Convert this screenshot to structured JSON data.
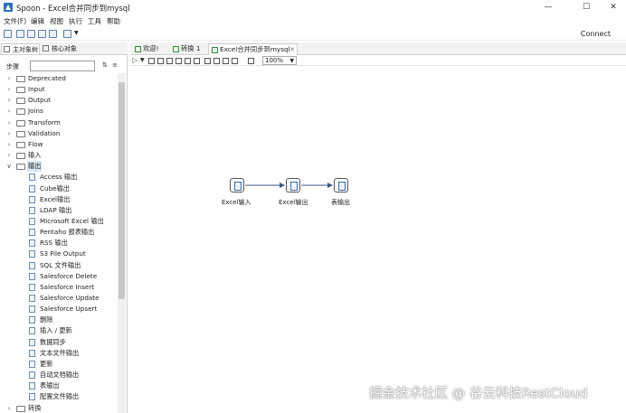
{
  "window": {
    "title": "Spoon - Excel合并同步到mysql"
  },
  "menu": [
    "文件(F)",
    "编辑",
    "视图",
    "执行",
    "工具",
    "帮助"
  ],
  "toolbar": {
    "connect_label": "Connect"
  },
  "left_tabs": [
    "主对象树",
    "核心对象"
  ],
  "steps_label": "步骤",
  "tree": [
    {
      "label": "Deprecated",
      "type": "folder",
      "expanded": false
    },
    {
      "label": "Input",
      "type": "folder",
      "expanded": false
    },
    {
      "label": "Output",
      "type": "folder",
      "expanded": false
    },
    {
      "label": "Joins",
      "type": "folder",
      "expanded": false
    },
    {
      "label": "Transform",
      "type": "folder",
      "expanded": false
    },
    {
      "label": "Validation",
      "type": "folder",
      "expanded": false
    },
    {
      "label": "Flow",
      "type": "folder",
      "expanded": false
    },
    {
      "label": "输入",
      "type": "folder",
      "expanded": false
    },
    {
      "label": "输出",
      "type": "folder",
      "expanded": true
    },
    {
      "label": "Access 输出",
      "type": "leaf"
    },
    {
      "label": "Cube输出",
      "type": "leaf"
    },
    {
      "label": "Excel输出",
      "type": "leaf"
    },
    {
      "label": "LDAP 输出",
      "type": "leaf"
    },
    {
      "label": "Microsoft Excel 输出",
      "type": "leaf"
    },
    {
      "label": "Pentaho 报表输出",
      "type": "leaf"
    },
    {
      "label": "RSS 输出",
      "type": "leaf"
    },
    {
      "label": "S3 File Output",
      "type": "leaf"
    },
    {
      "label": "SQL 文件输出",
      "type": "leaf"
    },
    {
      "label": "Salesforce Delete",
      "type": "leaf"
    },
    {
      "label": "Salesforce Insert",
      "type": "leaf"
    },
    {
      "label": "Salesforce Update",
      "type": "leaf"
    },
    {
      "label": "Salesforce Upsert",
      "type": "leaf"
    },
    {
      "label": "删除",
      "type": "leaf"
    },
    {
      "label": "插入 / 更新",
      "type": "leaf"
    },
    {
      "label": "数据同步",
      "type": "leaf"
    },
    {
      "label": "文本文件输出",
      "type": "leaf"
    },
    {
      "label": "更新",
      "type": "leaf"
    },
    {
      "label": "自动文档输出",
      "type": "leaf"
    },
    {
      "label": "表输出",
      "type": "leaf"
    },
    {
      "label": "配置文件输出",
      "type": "leaf"
    },
    {
      "label": "转换",
      "type": "folder",
      "expanded": false
    }
  ],
  "right_tabs": [
    {
      "label": "欢迎!"
    },
    {
      "label": "转换 1"
    },
    {
      "label": "Excel合并同步到mysql",
      "active": true
    }
  ],
  "zoom": "100%",
  "nodes": [
    {
      "label": "Excel输入"
    },
    {
      "label": "Excel输出"
    },
    {
      "label": "表输出"
    }
  ],
  "watermark": "掘金技术社区 @ 谷云科技RestCloud"
}
